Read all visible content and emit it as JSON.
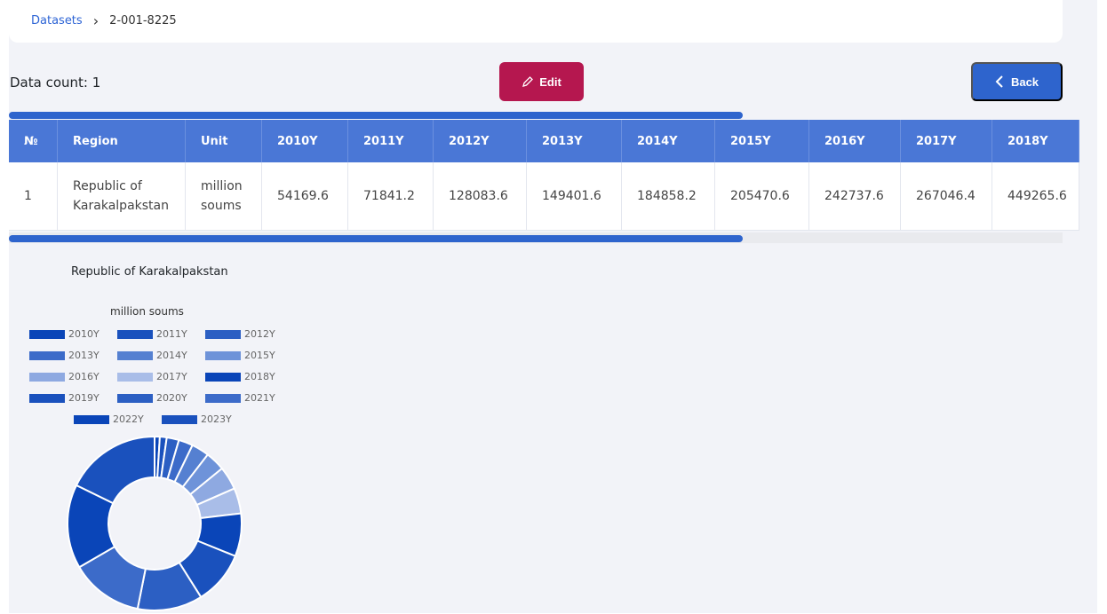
{
  "breadcrumb": {
    "root": "Datasets",
    "separator": "›",
    "current": "2-001-8225"
  },
  "data_count": "Data count: 1",
  "buttons": {
    "edit": "Edit",
    "back": "Back"
  },
  "table": {
    "headers": [
      "№",
      "Region",
      "Unit",
      "2010Y",
      "2011Y",
      "2012Y",
      "2013Y",
      "2014Y",
      "2015Y",
      "2016Y",
      "2017Y",
      "2018Y"
    ],
    "rows": [
      [
        "1",
        "Republic of Karakalpakstan",
        "million soums",
        "54169.6",
        "71841.2",
        "128083.6",
        "149401.6",
        "184858.2",
        "205470.6",
        "242737.6",
        "267046.4",
        "449265.6"
      ]
    ]
  },
  "chart_data": {
    "type": "pie",
    "title": "Republic of Karakalpakstan",
    "subtitle": "million soums",
    "categories": [
      "2010Y",
      "2011Y",
      "2012Y",
      "2013Y",
      "2014Y",
      "2015Y",
      "2016Y",
      "2017Y",
      "2018Y",
      "2019Y",
      "2020Y",
      "2021Y",
      "2022Y",
      "2023Y"
    ],
    "values": [
      54169.6,
      71841.2,
      128083.6,
      149401.6,
      184858.2,
      205470.6,
      242737.6,
      267046.4,
      449265.6,
      560000,
      680000,
      760000,
      880000,
      1000000
    ],
    "colors": [
      "#0a45b8",
      "#1a51bd",
      "#2c5fc3",
      "#3c6bc9",
      "#5580d1",
      "#6e93d9",
      "#8ea9e1",
      "#a9bde8",
      "#0a45b8",
      "#1a51bd",
      "#2c5fc3",
      "#3c6bc9",
      "#0a45b8",
      "#1a51bd"
    ],
    "legend_placement": "top"
  }
}
